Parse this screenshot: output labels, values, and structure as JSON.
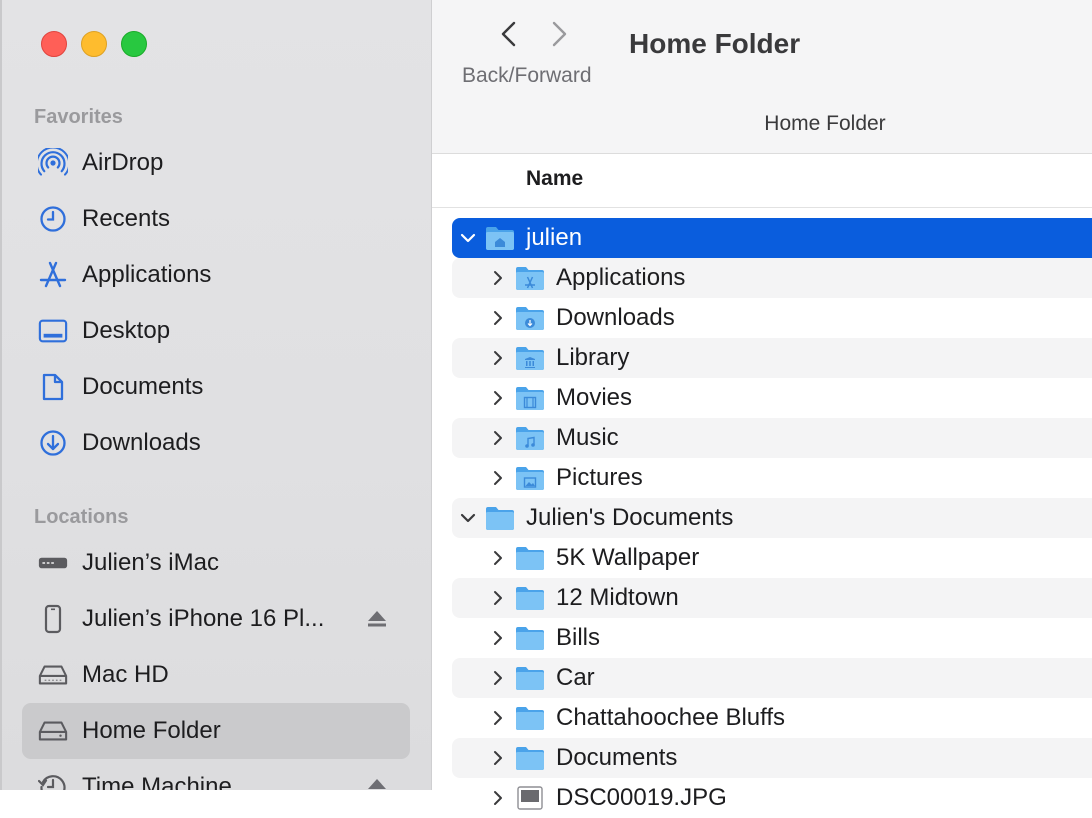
{
  "window": {
    "controls": [
      "close",
      "minimize",
      "zoom"
    ]
  },
  "toolbar": {
    "nav_caption": "Back/Forward",
    "title": "Home Folder",
    "path_title": "Home Folder"
  },
  "sidebar": {
    "favorites_header": "Favorites",
    "favorites": [
      {
        "label": "AirDrop",
        "icon": "airdrop-icon"
      },
      {
        "label": "Recents",
        "icon": "clock-icon"
      },
      {
        "label": "Applications",
        "icon": "applications-icon"
      },
      {
        "label": "Desktop",
        "icon": "desktop-icon"
      },
      {
        "label": "Documents",
        "icon": "document-icon"
      },
      {
        "label": "Downloads",
        "icon": "download-icon"
      }
    ],
    "locations_header": "Locations",
    "locations": [
      {
        "label": "Julien’s iMac",
        "icon": "computer-icon"
      },
      {
        "label": "Julien’s iPhone 16 Pl...",
        "icon": "iphone-icon",
        "eject": true
      },
      {
        "label": "Mac HD",
        "icon": "hard-drive-icon"
      },
      {
        "label": "Home Folder",
        "icon": "drive-icon",
        "selected": true
      },
      {
        "label": "Time Machine",
        "icon": "time-machine-icon",
        "eject": true
      }
    ]
  },
  "list": {
    "column_name": "Name",
    "rows": [
      {
        "label": "julien",
        "level": 0,
        "expanded": true,
        "selected": true,
        "icon": "home-folder-icon"
      },
      {
        "label": "Applications",
        "level": 1,
        "expanded": false,
        "icon": "applications-folder-icon"
      },
      {
        "label": "Downloads",
        "level": 1,
        "expanded": false,
        "icon": "downloads-folder-icon"
      },
      {
        "label": "Library",
        "level": 1,
        "expanded": false,
        "icon": "library-folder-icon"
      },
      {
        "label": "Movies",
        "level": 1,
        "expanded": false,
        "icon": "movies-folder-icon"
      },
      {
        "label": "Music",
        "level": 1,
        "expanded": false,
        "icon": "music-folder-icon"
      },
      {
        "label": "Pictures",
        "level": 1,
        "expanded": false,
        "icon": "pictures-folder-icon"
      },
      {
        "label": "Julien's Documents",
        "level": 0,
        "expanded": true,
        "icon": "folder-icon"
      },
      {
        "label": "5K Wallpaper",
        "level": 1,
        "expanded": false,
        "icon": "folder-icon"
      },
      {
        "label": "12 Midtown",
        "level": 1,
        "expanded": false,
        "icon": "folder-icon"
      },
      {
        "label": "Bills",
        "level": 1,
        "expanded": false,
        "icon": "folder-icon"
      },
      {
        "label": "Car",
        "level": 1,
        "expanded": false,
        "icon": "folder-icon"
      },
      {
        "label": "Chattahoochee Bluffs",
        "level": 1,
        "expanded": false,
        "icon": "folder-icon"
      },
      {
        "label": "Documents",
        "level": 1,
        "expanded": false,
        "icon": "folder-icon"
      },
      {
        "label": "DSC00019.JPG",
        "level": 1,
        "expanded": false,
        "icon": "image-file-icon"
      }
    ]
  },
  "colors": {
    "accent": "#0a5ddd",
    "sidebar_icon": "#2f6fdb",
    "folder": "#5fb3f2"
  }
}
